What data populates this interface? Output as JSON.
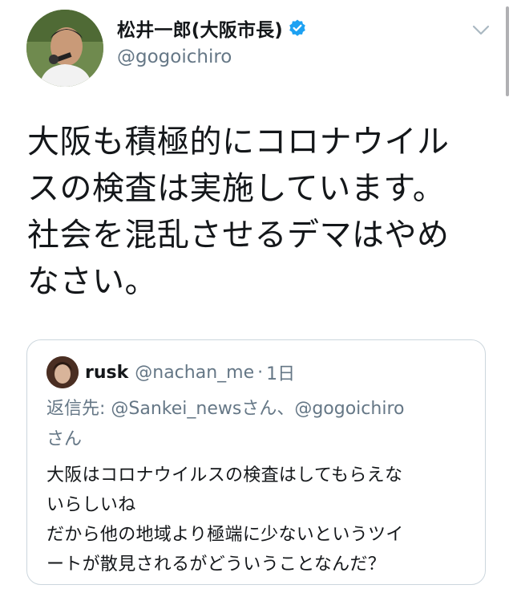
{
  "author": {
    "display_name": "松井一郎(大阪市長)",
    "handle": "@gogoichiro",
    "verified_icon": "verified-badge-icon",
    "avatar_icon": "avatar"
  },
  "menu_icon": "chevron-down-icon",
  "tweet": {
    "text_lines": [
      "大阪も積極的にコロナウイル",
      "スの検査は実施しています。",
      "社会を混乱させるデマはやめ",
      "なさい。"
    ]
  },
  "quoted_tweet": {
    "display_name": "rusk",
    "handle": "@nachan_me",
    "separator": "·",
    "time": "1日",
    "reply_to_line1": "返信先: @Sankei_newsさん、@gogoichiro",
    "reply_to_line2": "さん",
    "body_lines": [
      "大阪はコロナウイルスの検査はしてもらえな",
      "いらしいね",
      "だから他の地域より極端に少ないというツイ",
      "ートが散見されるがどういうことなんだ？"
    ]
  },
  "colors": {
    "text_primary": "#14171a",
    "text_secondary": "#657786",
    "verified_blue": "#1da1f2",
    "card_border": "#ccd6dd"
  }
}
